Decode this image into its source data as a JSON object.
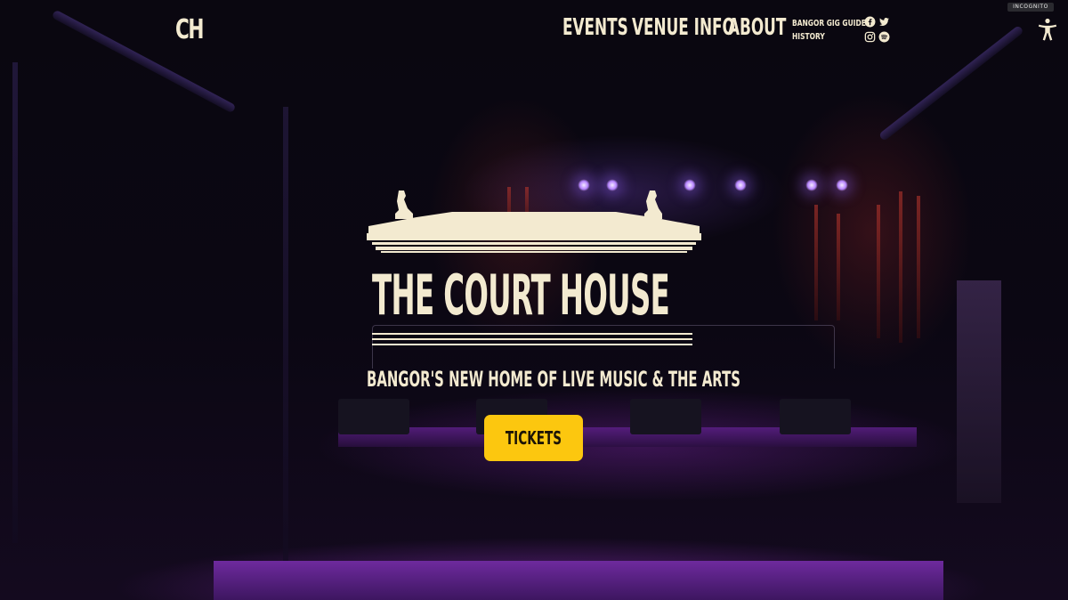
{
  "header": {
    "logo_text": "CH",
    "nav": [
      {
        "label": "EVENTS"
      },
      {
        "label": "VENUE INFO"
      },
      {
        "label": "ABOUT"
      }
    ],
    "subnav": [
      {
        "label": "BANGOR GIG GUIDE"
      },
      {
        "label": "HISTORY"
      }
    ],
    "social_icons": [
      "facebook-icon",
      "twitter-icon",
      "instagram-icon",
      "spotify-icon"
    ]
  },
  "browser": {
    "incognito_label": "INCOGNITO"
  },
  "accessibility": {
    "icon": "accessibility-icon"
  },
  "hero": {
    "title": "THE COURT HOUSE",
    "tagline": "BANGOR'S NEW HOME OF LIVE MUSIC & THE ARTS",
    "cta_label": "TICKETS"
  },
  "colors": {
    "cream": "#f3ead0",
    "cta": "#fcc70f",
    "background": "#07040b",
    "accent_purple": "#7a2fb0"
  }
}
